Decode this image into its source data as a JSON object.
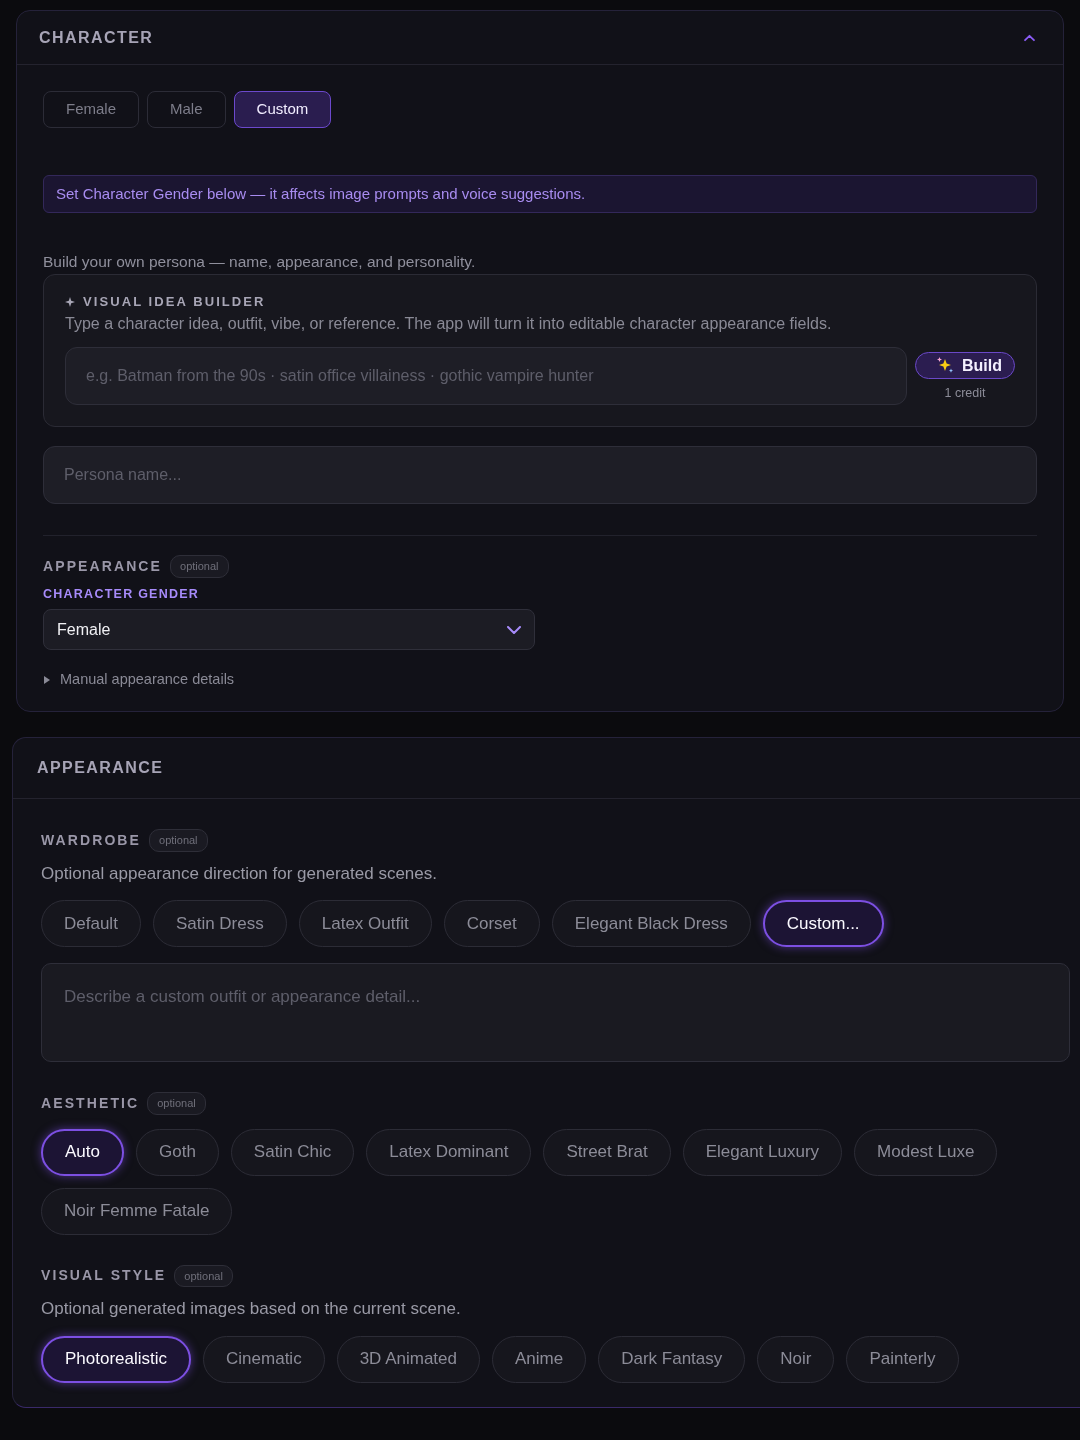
{
  "character_panel": {
    "title": "CHARACTER",
    "expanded": true,
    "gender_tabs": [
      {
        "label": "Female",
        "selected": false
      },
      {
        "label": "Male",
        "selected": false
      },
      {
        "label": "Custom",
        "selected": true
      }
    ],
    "notice": "Set Character Gender below — it affects image prompts and voice suggestions.",
    "intro": "Build your own persona — name, appearance, and personality.",
    "visual_idea_builder": {
      "title": "VISUAL IDEA BUILDER",
      "description": "Type a character idea, outfit, vibe, or reference. The app will turn it into editable character appearance fields.",
      "input": {
        "placeholder": "e.g. Batman from the 90s · satin office villainess · gothic vampire hunter"
      },
      "build_button": "Build",
      "cost": "1 credit"
    },
    "persona_name": {
      "placeholder": "Persona name..."
    },
    "appearance": {
      "title": "APPEARANCE",
      "badge": "optional",
      "gender_label": "CHARACTER GENDER",
      "gender_select": {
        "value": "Female"
      },
      "details_toggle": {
        "label": "Manual appearance details",
        "expanded": false
      }
    }
  },
  "appearance_panel": {
    "title": "APPEARANCE",
    "sections": [
      {
        "title": "WARDROBE",
        "badge": "optional",
        "description": "Optional appearance direction for generated scenes.",
        "options": [
          {
            "label": "Default",
            "selected": false
          },
          {
            "label": "Satin Dress",
            "selected": false
          },
          {
            "label": "Latex Outfit",
            "selected": false
          },
          {
            "label": "Corset",
            "selected": false
          },
          {
            "label": "Elegant Black Dress",
            "selected": false
          },
          {
            "label": "Custom...",
            "selected": true
          }
        ],
        "custom_field": {
          "placeholder": "Describe a custom outfit or appearance detail..."
        }
      },
      {
        "title": "AESTHETIC",
        "badge": "optional",
        "options": [
          {
            "label": "Auto",
            "selected": true
          },
          {
            "label": "Goth",
            "selected": false
          },
          {
            "label": "Satin Chic",
            "selected": false
          },
          {
            "label": "Latex Dominant",
            "selected": false
          },
          {
            "label": "Street Brat",
            "selected": false
          },
          {
            "label": "Elegant Luxury",
            "selected": false
          },
          {
            "label": "Modest Luxe",
            "selected": false
          },
          {
            "label": "Noir Femme Fatale",
            "selected": false
          }
        ]
      },
      {
        "title": "VISUAL STYLE",
        "badge": "optional",
        "description": "Optional generated images based on the current scene.",
        "options": [
          {
            "label": "Photorealistic",
            "selected": true
          },
          {
            "label": "Cinematic",
            "selected": false
          },
          {
            "label": "3D Animated",
            "selected": false
          },
          {
            "label": "Anime",
            "selected": false
          },
          {
            "label": "Dark Fantasy",
            "selected": false
          },
          {
            "label": "Noir",
            "selected": false
          },
          {
            "label": "Painterly",
            "selected": false
          }
        ]
      }
    ]
  }
}
